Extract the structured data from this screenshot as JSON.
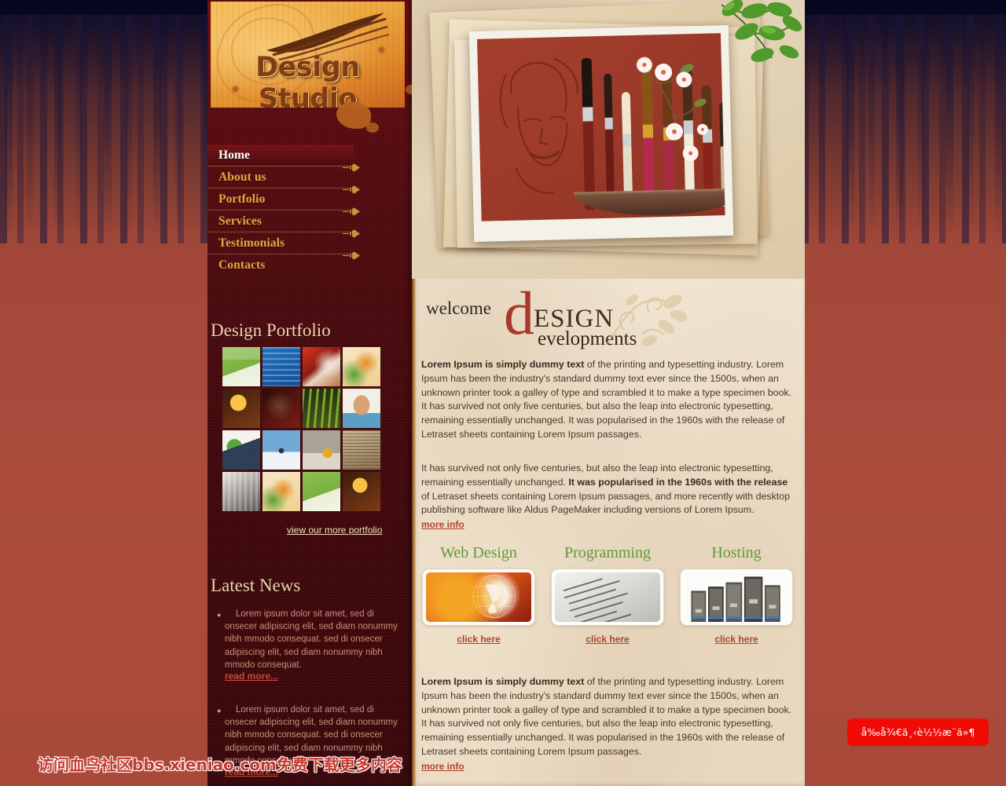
{
  "site": {
    "logo_text": "Design Studio"
  },
  "nav": {
    "items": [
      {
        "label": "Home",
        "active": true
      },
      {
        "label": "About us",
        "active": false
      },
      {
        "label": "Portfolio",
        "active": false
      },
      {
        "label": "Services",
        "active": false
      },
      {
        "label": "Testimonials",
        "active": false
      },
      {
        "label": "Contacts",
        "active": false
      }
    ]
  },
  "sidebar": {
    "portfolio_heading": "Design Portfolio",
    "portfolio_link": "view our more portfolio",
    "news_heading": "Latest News",
    "news_items": [
      {
        "text": "Lorem ipsum dolor sit amet, sed di onsecer adipiscing elit, sed diam nonummy nibh mmodo consequat. sed di onsecer adipiscing elit, sed diam nonummy nibh mmodo consequat.",
        "link": "read more..."
      },
      {
        "text": "Lorem ipsum dolor sit amet, sed di onsecer adipiscing elit, sed diam nonummy nibh mmodo consequat. sed di onsecer adipiscing elit, sed diam nonummy nibh mmodo consequat.",
        "link": "read more..."
      }
    ],
    "thumbnails": [
      [
        "studio-green-poster",
        "blue-text-poster",
        "red-face-art",
        "orange-sport-art"
      ],
      [
        "sunburst-badge",
        "basketball-player",
        "green-abstract",
        "child-illustration"
      ],
      [
        "green-box-product",
        "snow-people-photo",
        "construction-toys",
        "old-newspaper"
      ],
      [
        "bw-portrait-art",
        "orange-sport-art-2",
        "studio-green-poster-2",
        "sunburst-badge-2"
      ]
    ]
  },
  "banner": {
    "alt": "paintbrushes-collage-photo"
  },
  "main": {
    "welcome_word": "welcome",
    "brand_initial": "d",
    "brand_line1": "ESIGN",
    "brand_line2": "evelopments",
    "para_1_bold": "Lorem Ipsum is simply dummy text",
    "para_1_rest": " of the printing and typesetting industry. Lorem Ipsum has been the industry's standard dummy text ever since the 1500s, when an unknown printer took a galley of type and scrambled it to make a type specimen book. It has survived not only five centuries, but also the leap into electronic typesetting, remaining essentially unchanged. It was popularised in the 1960s with the release of Letraset sheets containing Lorem Ipsum passages.",
    "para_2_pre": "It has survived not only five centuries, but also the leap into electronic typesetting, remaining essentially unchanged. ",
    "para_2_bold": "It was popularised in the 1960s with the release",
    "para_2_post": " of Letraset sheets containing Lorem Ipsum passages, and more recently with desktop publishing software like Aldus PageMaker including versions of Lorem Ipsum.",
    "more_info_1": "more info",
    "para_3_bold": "Lorem Ipsum is simply dummy text",
    "para_3_rest": " of the printing and typesetting industry. Lorem Ipsum has been the industry's standard dummy text ever since the 1500s, when an unknown printer took a galley of type and scrambled it to make a type specimen book. It has survived not only five centuries, but also the leap into electronic typesetting, remaining essentially unchanged. It was popularised in the 1960s with the release of Letraset sheets containing Lorem Ipsum passages.",
    "more_info_2": "more info",
    "services": [
      {
        "title": "Web Design",
        "image": "globe-network-image",
        "link": "click here"
      },
      {
        "title": "Programming",
        "image": "html-code-listing-image",
        "link": "click here"
      },
      {
        "title": "Hosting",
        "image": "server-racks-image",
        "link": "click here"
      }
    ]
  },
  "watermarks": {
    "left": "访问血鸟社区bbs.xieniao.com免费下载更多内容",
    "badge": "å‰å¾€ä¸‹è½½æ¨ä»¶"
  },
  "colors": {
    "sidebar": "#4d0c10",
    "accent_gold": "#e8a73e",
    "link_red": "#b0442c",
    "service_green": "#5f9a3b",
    "page_red": "#a8493a"
  }
}
